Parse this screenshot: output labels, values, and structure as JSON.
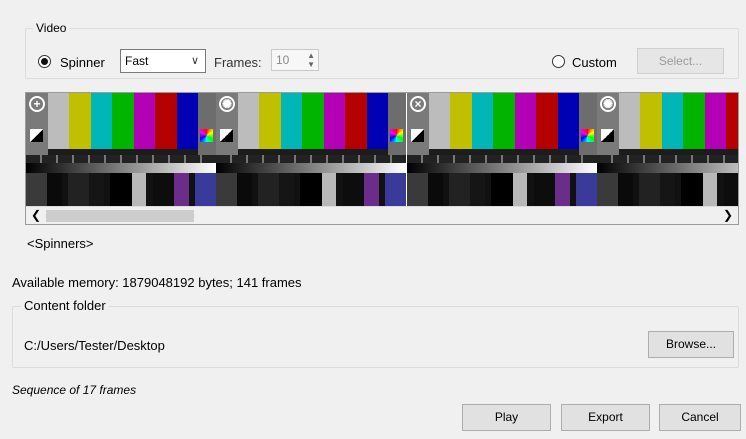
{
  "video": {
    "group_label": "Video",
    "spinner_label": "Spinner",
    "speed_value": "Fast",
    "frames_label": "Frames:",
    "frames_value": "10",
    "custom_label": "Custom",
    "select_label": "Select..."
  },
  "preview": {
    "spinners_label": "<Spinners>",
    "bar_colors": [
      "#bcbcbc",
      "#c0c000",
      "#00b6b6",
      "#00b400",
      "#b400b4",
      "#b40000",
      "#0000b4"
    ],
    "icons": [
      "crosshair-icon",
      "spinner-icon",
      "close-circle-icon",
      "spinner-icon"
    ]
  },
  "memory_text": "Available memory: 1879048192 bytes; 141 frames",
  "content": {
    "group_label": "Content folder",
    "path": "C:/Users/Tester/Desktop",
    "browse_label": "Browse..."
  },
  "sequence_text": "Sequence of 17 frames",
  "actions": {
    "play": "Play",
    "export": "Export",
    "cancel": "Cancel"
  }
}
